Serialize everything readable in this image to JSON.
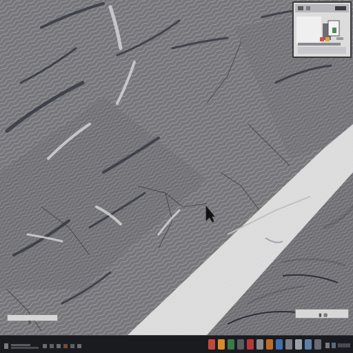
{
  "desktop": {
    "background_pattern": "grey-wavy-texture",
    "background_color": "#6f6f72",
    "stripe_color": "#e2e2e2"
  },
  "minimap": {
    "icon": "window-thumbnail-icon",
    "background_color": "#dcdcdc"
  },
  "panels": {
    "left_bar_icon": "panel-bar-icon",
    "right_bar_icon": "panel-bar-icon"
  },
  "cursor": {
    "icon": "mouse-pointer-icon"
  },
  "taskbar": {
    "background_color": "#1a1b1f",
    "apps": [
      {
        "icon": "app-icon",
        "color": "#c2483b"
      },
      {
        "icon": "app-icon",
        "color": "#d98a2b"
      },
      {
        "icon": "app-icon",
        "color": "#3a7a4a"
      },
      {
        "icon": "app-icon",
        "color": "#5b5b63"
      },
      {
        "icon": "app-icon",
        "color": "#b43a3a"
      },
      {
        "icon": "app-icon",
        "color": "#8a8a90"
      },
      {
        "icon": "app-icon",
        "color": "#c06a2e"
      },
      {
        "icon": "app-icon",
        "color": "#3f6fb0"
      },
      {
        "icon": "app-icon",
        "color": "#7d7d84"
      },
      {
        "icon": "app-icon",
        "color": "#9aa0a8"
      },
      {
        "icon": "app-icon",
        "color": "#5c7fa8"
      },
      {
        "icon": "app-icon",
        "color": "#6a6a72"
      }
    ],
    "tray": {
      "icon": "system-tray-icon"
    }
  }
}
